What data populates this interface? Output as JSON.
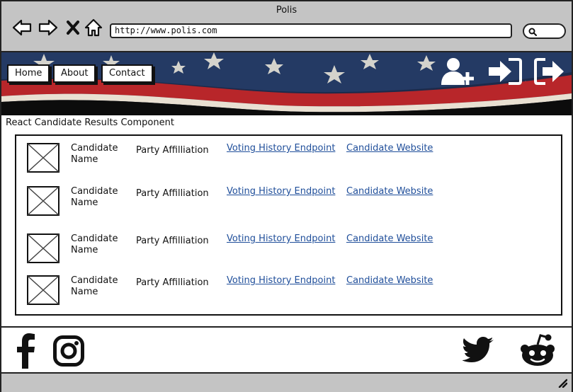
{
  "window": {
    "title": "Polis"
  },
  "toolbar": {
    "icons": [
      "back-arrow-icon",
      "forward-arrow-icon",
      "close-icon",
      "home-icon",
      "search-icon"
    ],
    "url": "http://www.polis.com"
  },
  "nav": {
    "home": "Home",
    "about": "About",
    "contact": "Contact"
  },
  "banner_icons": [
    "add-user-icon",
    "sign-in-icon",
    "sign-out-icon"
  ],
  "section_title": "React Candidate Results Component",
  "results": [
    {
      "name": "Candidate Name",
      "party": "Party Affilliation",
      "voting_link": "Voting History Endpoint",
      "website_link": "Candidate Website"
    },
    {
      "name": "Candidate Name",
      "party": "Party Affilliation",
      "voting_link": "Voting History Endpoint",
      "website_link": "Candidate Website"
    },
    {
      "name": "Candidate Name",
      "party": "Party Affilliation",
      "voting_link": "Voting History Endpoint",
      "website_link": "Candidate Website"
    },
    {
      "name": "Candidate Name",
      "party": "Party Affilliation",
      "voting_link": "Voting History Endpoint",
      "website_link": "Candidate Website"
    }
  ],
  "footer_icons": [
    "facebook-icon",
    "instagram-icon",
    "twitter-icon",
    "reddit-icon"
  ],
  "colors": {
    "link": "#1f4e9a",
    "flag_red": "#b8262a",
    "chrome": "#c4c4c4"
  }
}
